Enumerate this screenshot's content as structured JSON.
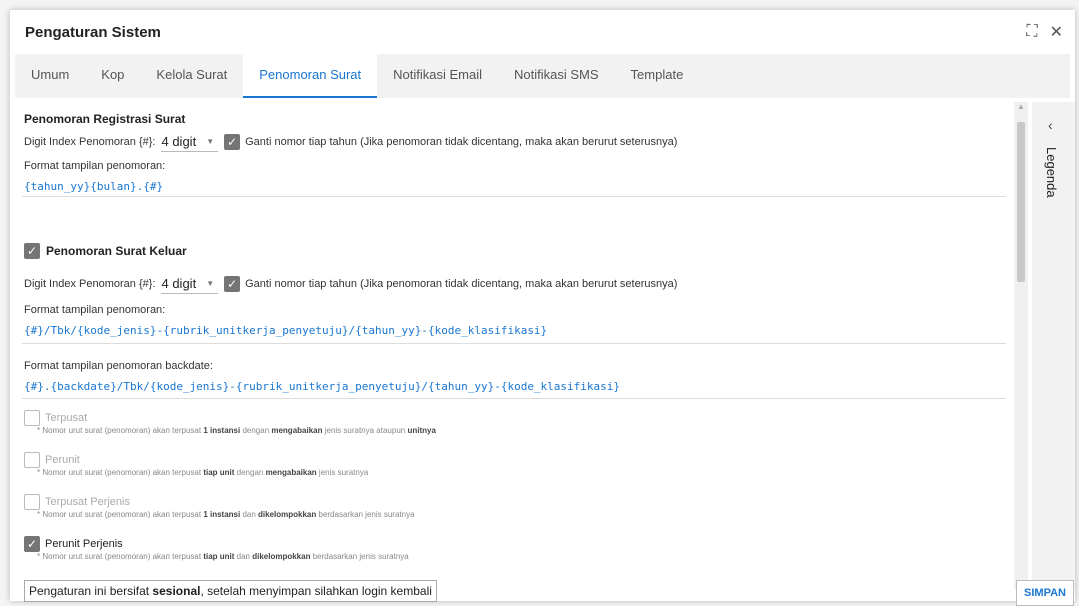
{
  "dialog": {
    "title": "Pengaturan Sistem",
    "fullscreen_icon": "fullscreen-icon",
    "close_icon": "close-icon"
  },
  "tabs": [
    {
      "label": "Umum"
    },
    {
      "label": "Kop"
    },
    {
      "label": "Kelola Surat"
    },
    {
      "label": "Penomoran Surat",
      "active": true
    },
    {
      "label": "Notifikasi Email"
    },
    {
      "label": "Notifikasi SMS"
    },
    {
      "label": "Template"
    }
  ],
  "registrasi": {
    "title": "Penomoran Registrasi Surat",
    "digit_label": "Digit Index Penomoran {#}:",
    "digit_value": "4 digit",
    "reset_label": "Ganti nomor tiap tahun (Jika penomoran tidak dicentang, maka akan berurut seterusnya)",
    "reset_checked": true,
    "format_label": "Format tampilan penomoran:",
    "format_value": "{tahun_yy}{bulan}.{#}"
  },
  "keluar": {
    "title": "Penomoran Surat Keluar",
    "enabled": true,
    "digit_label": "Digit Index Penomoran {#}:",
    "digit_value": "4 digit",
    "reset_label": "Ganti nomor tiap tahun (Jika penomoran tidak dicentang, maka akan berurut seterusnya)",
    "reset_checked": true,
    "format_label": "Format tampilan penomoran:",
    "format_value": "{#}/Tbk/{kode_jenis}-{rubrik_unitkerja_penyetuju}/{tahun_yy}-{kode_klasifikasi}",
    "backdate_label": "Format tampilan penomoran backdate:",
    "backdate_value": "{#}.{backdate}/Tbk/{kode_jenis}-{rubrik_unitkerja_penyetuju}/{tahun_yy}-{kode_klasifikasi}"
  },
  "options": {
    "terpusat": {
      "title": "Terpusat",
      "checked": false,
      "note_a": "* Nomor urut surat (penomoran) akan terpusat ",
      "note_b1": "1 instansi",
      "note_c": " dengan ",
      "note_b2": "mengabaikan",
      "note_d": " jenis suratnya ataupun ",
      "note_b3": "unitnya"
    },
    "perunit": {
      "title": "Perunit",
      "checked": false,
      "note_a": "* Nomor urut surat (penomoran) akan terpusat ",
      "note_b1": "tiap unit",
      "note_c": " dengan ",
      "note_b2": "mengabaikan",
      "note_d": " jenis suratnya"
    },
    "terpusat_perjenis": {
      "title": "Terpusat Perjenis",
      "checked": false,
      "note_a": "* Nomor urut surat (penomoran) akan terpusat ",
      "note_b1": "1 instansi",
      "note_c": " dan ",
      "note_b2": "dikelompokkan",
      "note_d": " berdasarkan jenis suratnya"
    },
    "perunit_perjenis": {
      "title": "Perunit Perjenis",
      "checked": true,
      "note_a": "* Nomor urut surat (penomoran) akan terpusat ",
      "note_b1": "tiap unit",
      "note_c": " dan ",
      "note_b2": "dikelompokkan",
      "note_d": " berdasarkan jenis suratnya"
    }
  },
  "legend": {
    "label": "Legenda",
    "toggle_icon": "chevron-left-icon"
  },
  "footer": {
    "note_a": "Pengaturan ini bersifat ",
    "note_b": "sesional",
    "note_c": ", setelah menyimpan silahkan login kembali",
    "save_label": "SIMPAN"
  },
  "colors": {
    "accent": "#1976d2",
    "checkbox": "#757575"
  }
}
